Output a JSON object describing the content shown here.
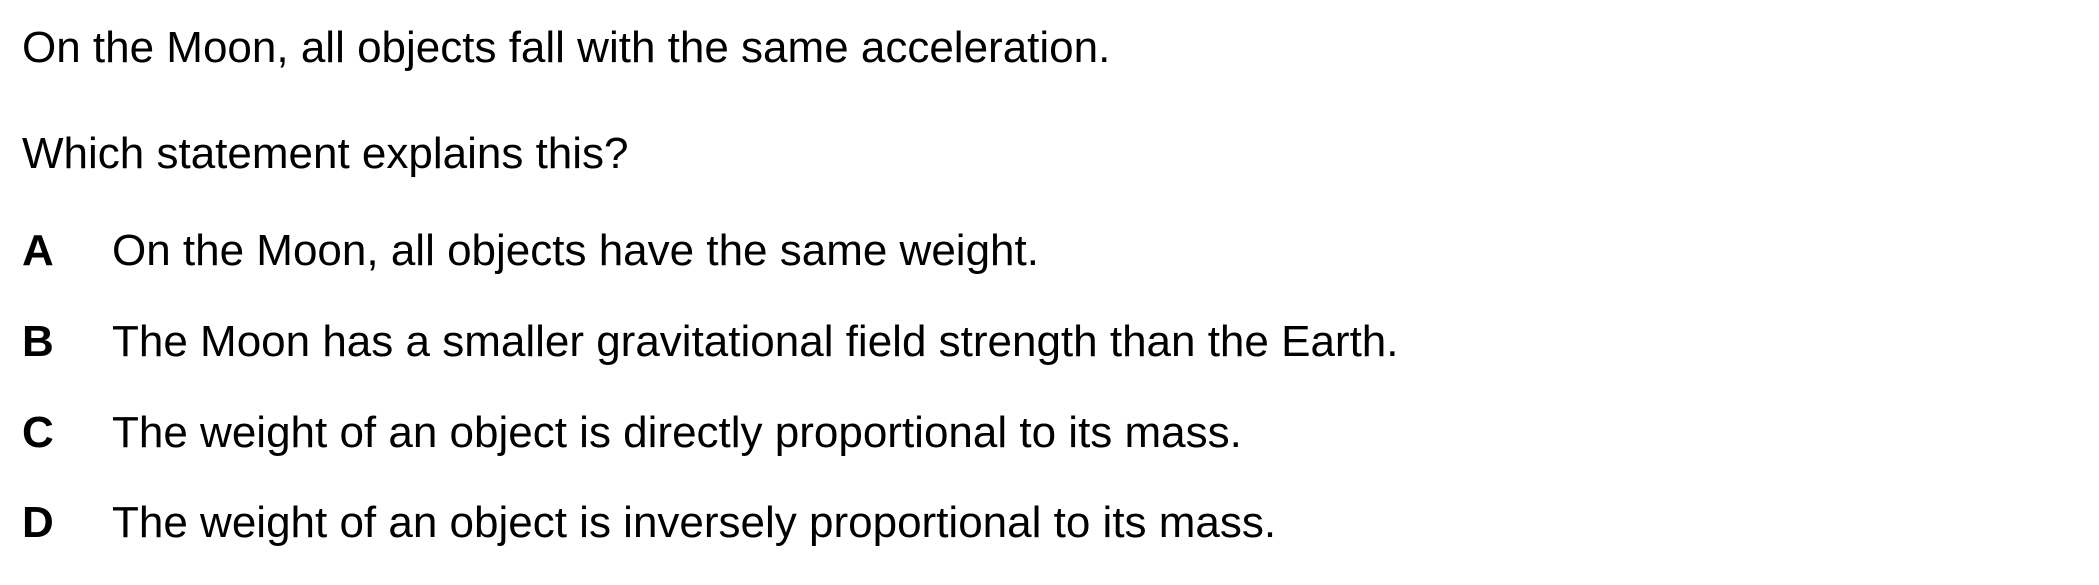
{
  "question": {
    "stem": "On the Moon, all objects fall with the same acceleration.",
    "prompt": "Which statement explains this?",
    "options": [
      {
        "letter": "A",
        "text": "On the Moon, all objects have the same weight."
      },
      {
        "letter": "B",
        "text": "The Moon has a smaller gravitational field strength than the Earth."
      },
      {
        "letter": "C",
        "text": "The weight of an object is directly proportional to its mass."
      },
      {
        "letter": "D",
        "text": "The weight of an object is inversely proportional to its mass."
      }
    ]
  }
}
